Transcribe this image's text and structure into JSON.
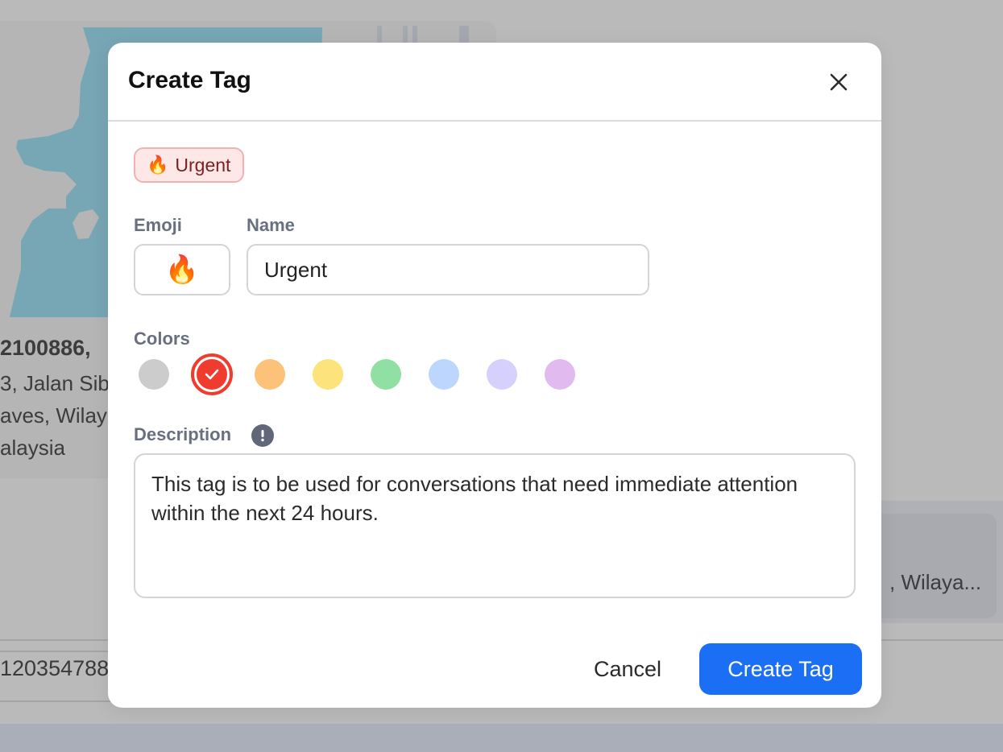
{
  "background": {
    "address": {
      "line1": "2100886,",
      "line2": "3, Jalan Sib",
      "line3": "aves, Wilay",
      "line4": "alaysia"
    },
    "right_card_text": ", Wilaya...",
    "phone": "120354788",
    "map_water_color": "#77a6b4"
  },
  "modal": {
    "title": "Create Tag",
    "close_icon": "close-icon",
    "preview_tag": {
      "emoji": "🔥",
      "label": "Urgent"
    },
    "emoji_label": "Emoji",
    "emoji_value": "🔥",
    "name_label": "Name",
    "name_value": "Urgent",
    "name_placeholder": "",
    "colors_label": "Colors",
    "colors": [
      {
        "name": "gray",
        "hex": "#cccccc",
        "selected": false
      },
      {
        "name": "red",
        "hex": "#f03c2e",
        "selected": true
      },
      {
        "name": "orange",
        "hex": "#fdc27a",
        "selected": false
      },
      {
        "name": "yellow",
        "hex": "#fde37c",
        "selected": false
      },
      {
        "name": "green",
        "hex": "#90e0a3",
        "selected": false
      },
      {
        "name": "blue",
        "hex": "#bcd6fd",
        "selected": false
      },
      {
        "name": "lavender",
        "hex": "#d5d1fc",
        "selected": false
      },
      {
        "name": "purple",
        "hex": "#e1bbf0",
        "selected": false
      }
    ],
    "description_label": "Description",
    "description_info_icon": "info-icon",
    "description_value": "This tag is to be used for conversations that need immediate attention within the next 24 hours.",
    "cancel_label": "Cancel",
    "create_label": "Create Tag",
    "accent_color": "#1a6ff5"
  }
}
